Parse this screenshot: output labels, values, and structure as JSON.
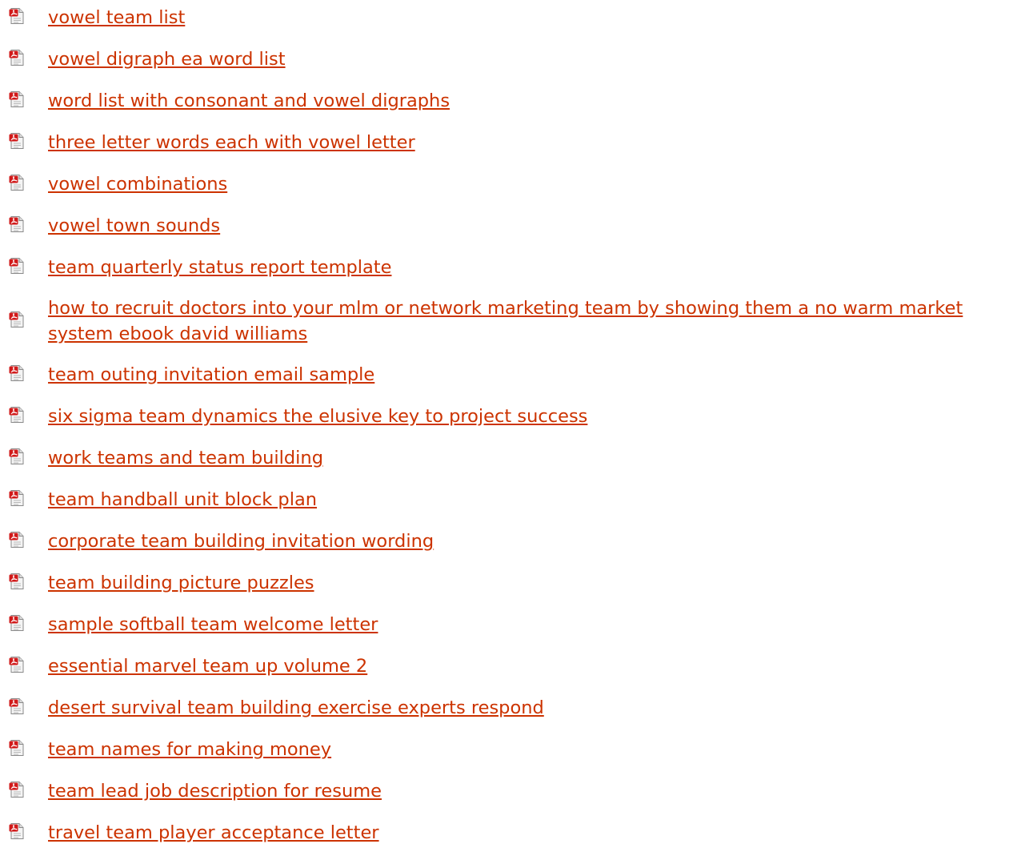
{
  "list": {
    "icon": "pdf-document-icon",
    "link_color": "#cc3300",
    "items": [
      {
        "label": "vowel team list"
      },
      {
        "label": "vowel digraph ea word list"
      },
      {
        "label": "word list with consonant and vowel digraphs"
      },
      {
        "label": "three letter words each with vowel letter"
      },
      {
        "label": "vowel combinations"
      },
      {
        "label": "vowel town sounds"
      },
      {
        "label": "team quarterly status report template"
      },
      {
        "label": "how to recruit doctors into your mlm or network marketing team by showing them a no warm market system ebook david williams"
      },
      {
        "label": "team outing invitation email sample"
      },
      {
        "label": "six sigma team dynamics the elusive key to project success"
      },
      {
        "label": "work teams and team building"
      },
      {
        "label": "team handball unit block plan"
      },
      {
        "label": "corporate team building invitation wording"
      },
      {
        "label": "team building picture puzzles"
      },
      {
        "label": "sample softball team welcome letter"
      },
      {
        "label": "essential marvel team up volume 2"
      },
      {
        "label": "desert survival team building exercise experts respond"
      },
      {
        "label": "team names for making money"
      },
      {
        "label": "team lead job description for resume"
      },
      {
        "label": "travel team player acceptance letter"
      }
    ]
  }
}
